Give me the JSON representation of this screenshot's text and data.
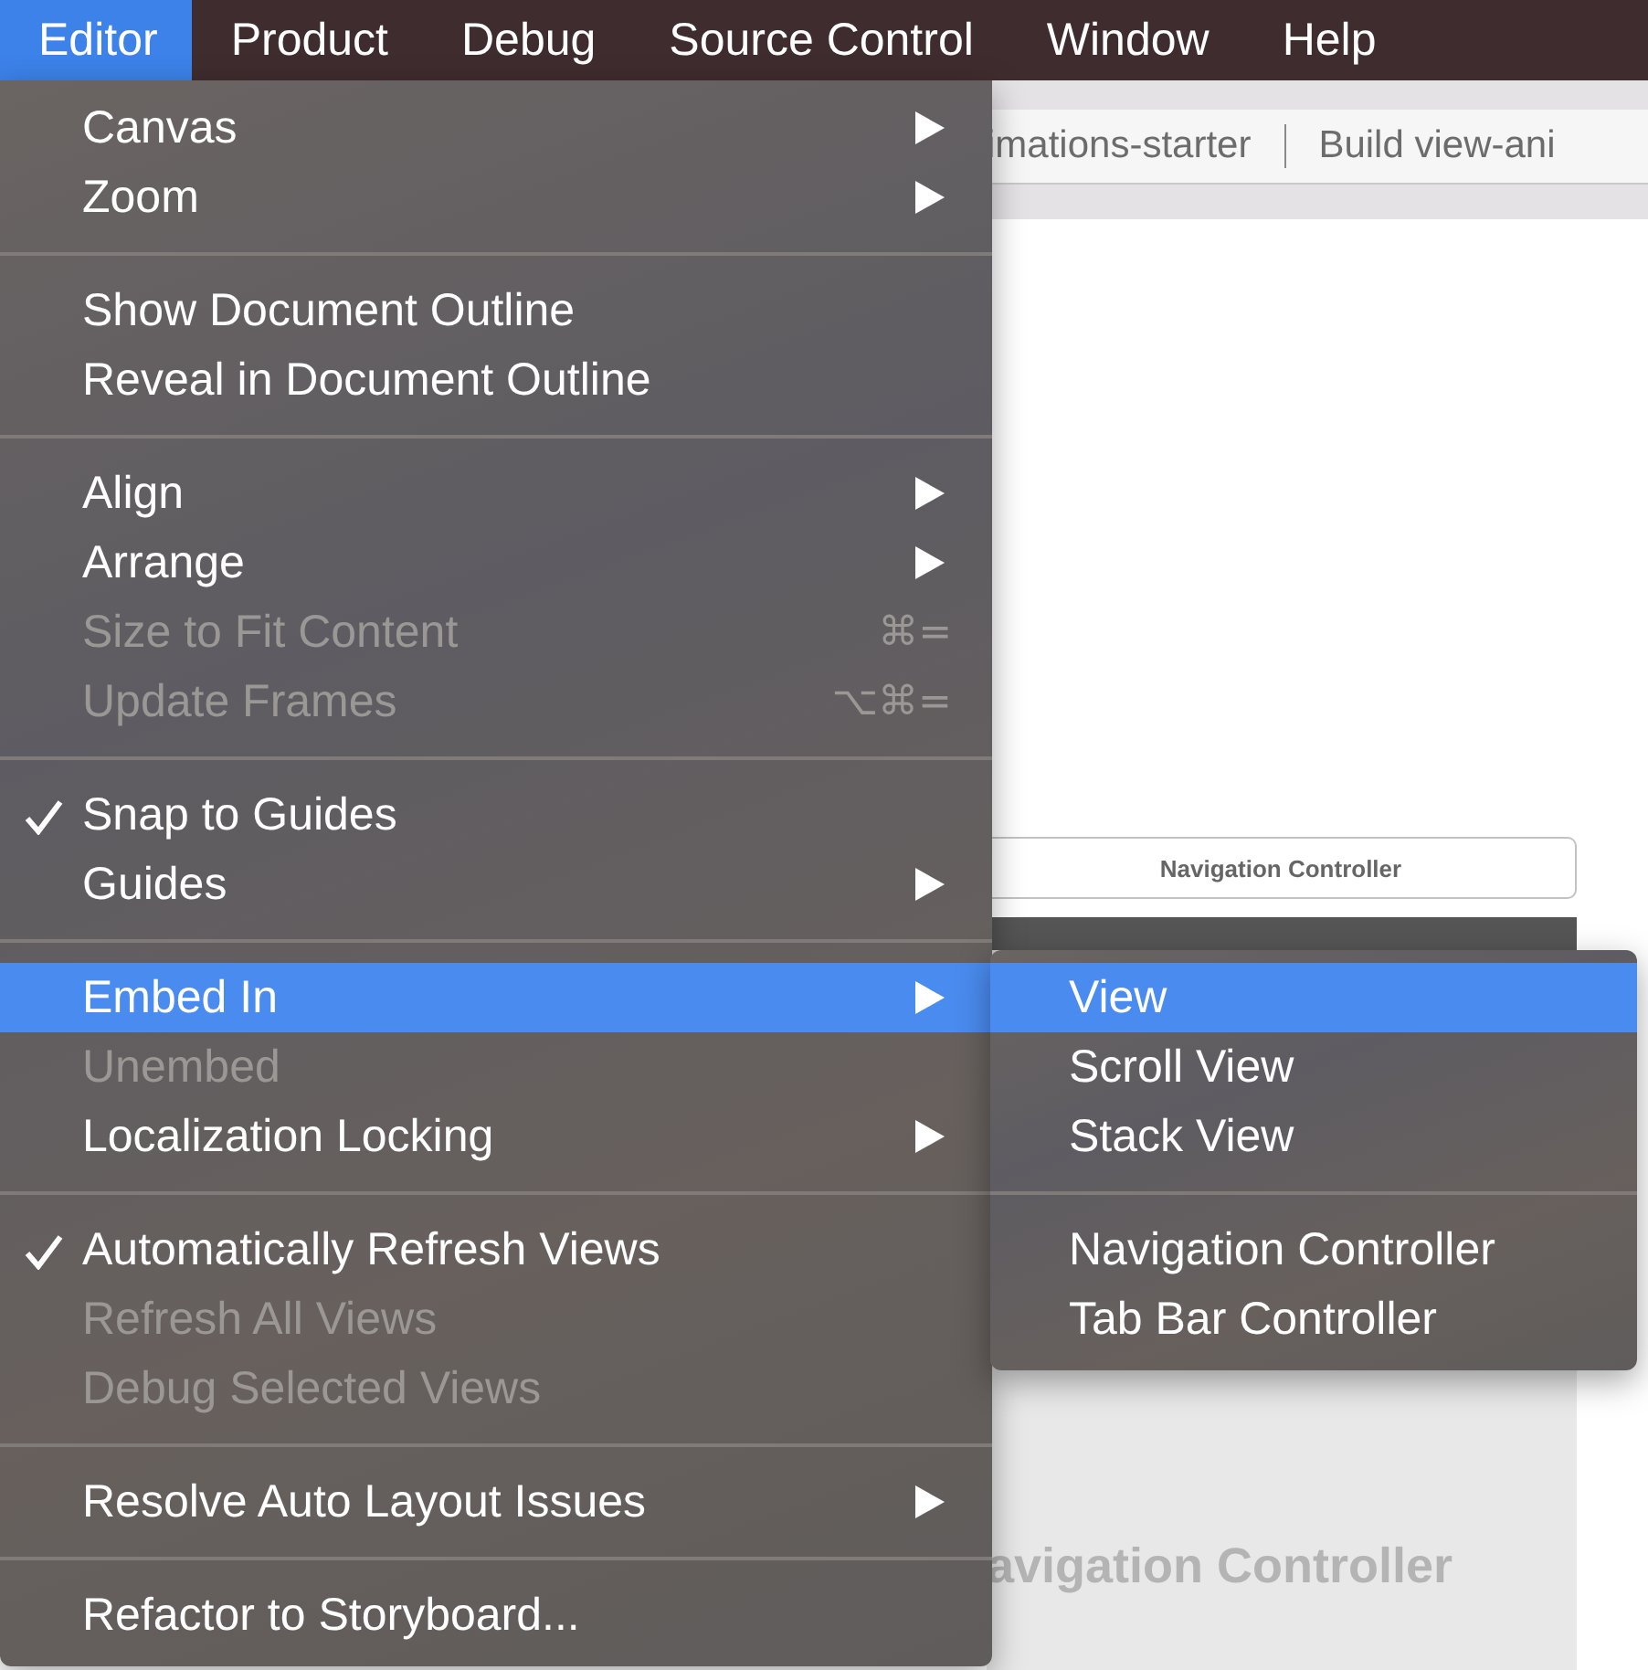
{
  "menu_bar": {
    "items": [
      {
        "label": "Editor",
        "selected": true
      },
      {
        "label": "Product",
        "selected": false
      },
      {
        "label": "Debug",
        "selected": false
      },
      {
        "label": "Source Control",
        "selected": false
      },
      {
        "label": "Window",
        "selected": false
      },
      {
        "label": "Help",
        "selected": false
      }
    ]
  },
  "toolbar": {
    "scheme": "imations-starter",
    "status": "Build view-ani"
  },
  "canvas": {
    "scene_title": "Navigation Controller",
    "scene_label": "avigation Controller"
  },
  "editor_menu": {
    "groups": [
      {
        "items": [
          {
            "label": "Canvas",
            "checked": false,
            "disabled": false,
            "submenu": true,
            "selected": false
          },
          {
            "label": "Zoom",
            "checked": false,
            "disabled": false,
            "submenu": true,
            "selected": false
          }
        ]
      },
      {
        "items": [
          {
            "label": "Show Document Outline",
            "checked": false,
            "disabled": false,
            "submenu": false,
            "selected": false
          },
          {
            "label": "Reveal in Document Outline",
            "checked": false,
            "disabled": false,
            "submenu": false,
            "selected": false
          }
        ]
      },
      {
        "items": [
          {
            "label": "Align",
            "checked": false,
            "disabled": false,
            "submenu": true,
            "selected": false
          },
          {
            "label": "Arrange",
            "checked": false,
            "disabled": false,
            "submenu": true,
            "selected": false
          },
          {
            "label": "Size to Fit Content",
            "checked": false,
            "disabled": true,
            "submenu": false,
            "shortcut": "⌘=",
            "selected": false
          },
          {
            "label": "Update Frames",
            "checked": false,
            "disabled": true,
            "submenu": false,
            "shortcut": "⌥⌘=",
            "selected": false
          }
        ]
      },
      {
        "items": [
          {
            "label": "Snap to Guides",
            "checked": true,
            "disabled": false,
            "submenu": false,
            "selected": false
          },
          {
            "label": "Guides",
            "checked": false,
            "disabled": false,
            "submenu": true,
            "selected": false
          }
        ]
      },
      {
        "items": [
          {
            "label": "Embed In",
            "checked": false,
            "disabled": false,
            "submenu": true,
            "selected": true
          },
          {
            "label": "Unembed",
            "checked": false,
            "disabled": true,
            "submenu": false,
            "selected": false
          },
          {
            "label": "Localization Locking",
            "checked": false,
            "disabled": false,
            "submenu": true,
            "selected": false
          }
        ]
      },
      {
        "items": [
          {
            "label": "Automatically Refresh Views",
            "checked": true,
            "disabled": false,
            "submenu": false,
            "selected": false
          },
          {
            "label": "Refresh All Views",
            "checked": false,
            "disabled": true,
            "submenu": false,
            "selected": false
          },
          {
            "label": "Debug Selected Views",
            "checked": false,
            "disabled": true,
            "submenu": false,
            "selected": false
          }
        ]
      },
      {
        "items": [
          {
            "label": "Resolve Auto Layout Issues",
            "checked": false,
            "disabled": false,
            "submenu": true,
            "selected": false
          }
        ]
      },
      {
        "items": [
          {
            "label": "Refactor to Storyboard...",
            "checked": false,
            "disabled": false,
            "submenu": false,
            "selected": false
          }
        ]
      }
    ]
  },
  "embed_submenu": {
    "groups": [
      {
        "items": [
          {
            "label": "View",
            "checked": false,
            "disabled": false,
            "submenu": false,
            "selected": true
          },
          {
            "label": "Scroll View",
            "checked": false,
            "disabled": false,
            "submenu": false,
            "selected": false
          },
          {
            "label": "Stack View",
            "checked": false,
            "disabled": false,
            "submenu": false,
            "selected": false
          }
        ]
      },
      {
        "items": [
          {
            "label": "Navigation Controller",
            "checked": false,
            "disabled": false,
            "submenu": false,
            "selected": false
          },
          {
            "label": "Tab Bar Controller",
            "checked": false,
            "disabled": false,
            "submenu": false,
            "selected": false
          }
        ]
      }
    ]
  }
}
